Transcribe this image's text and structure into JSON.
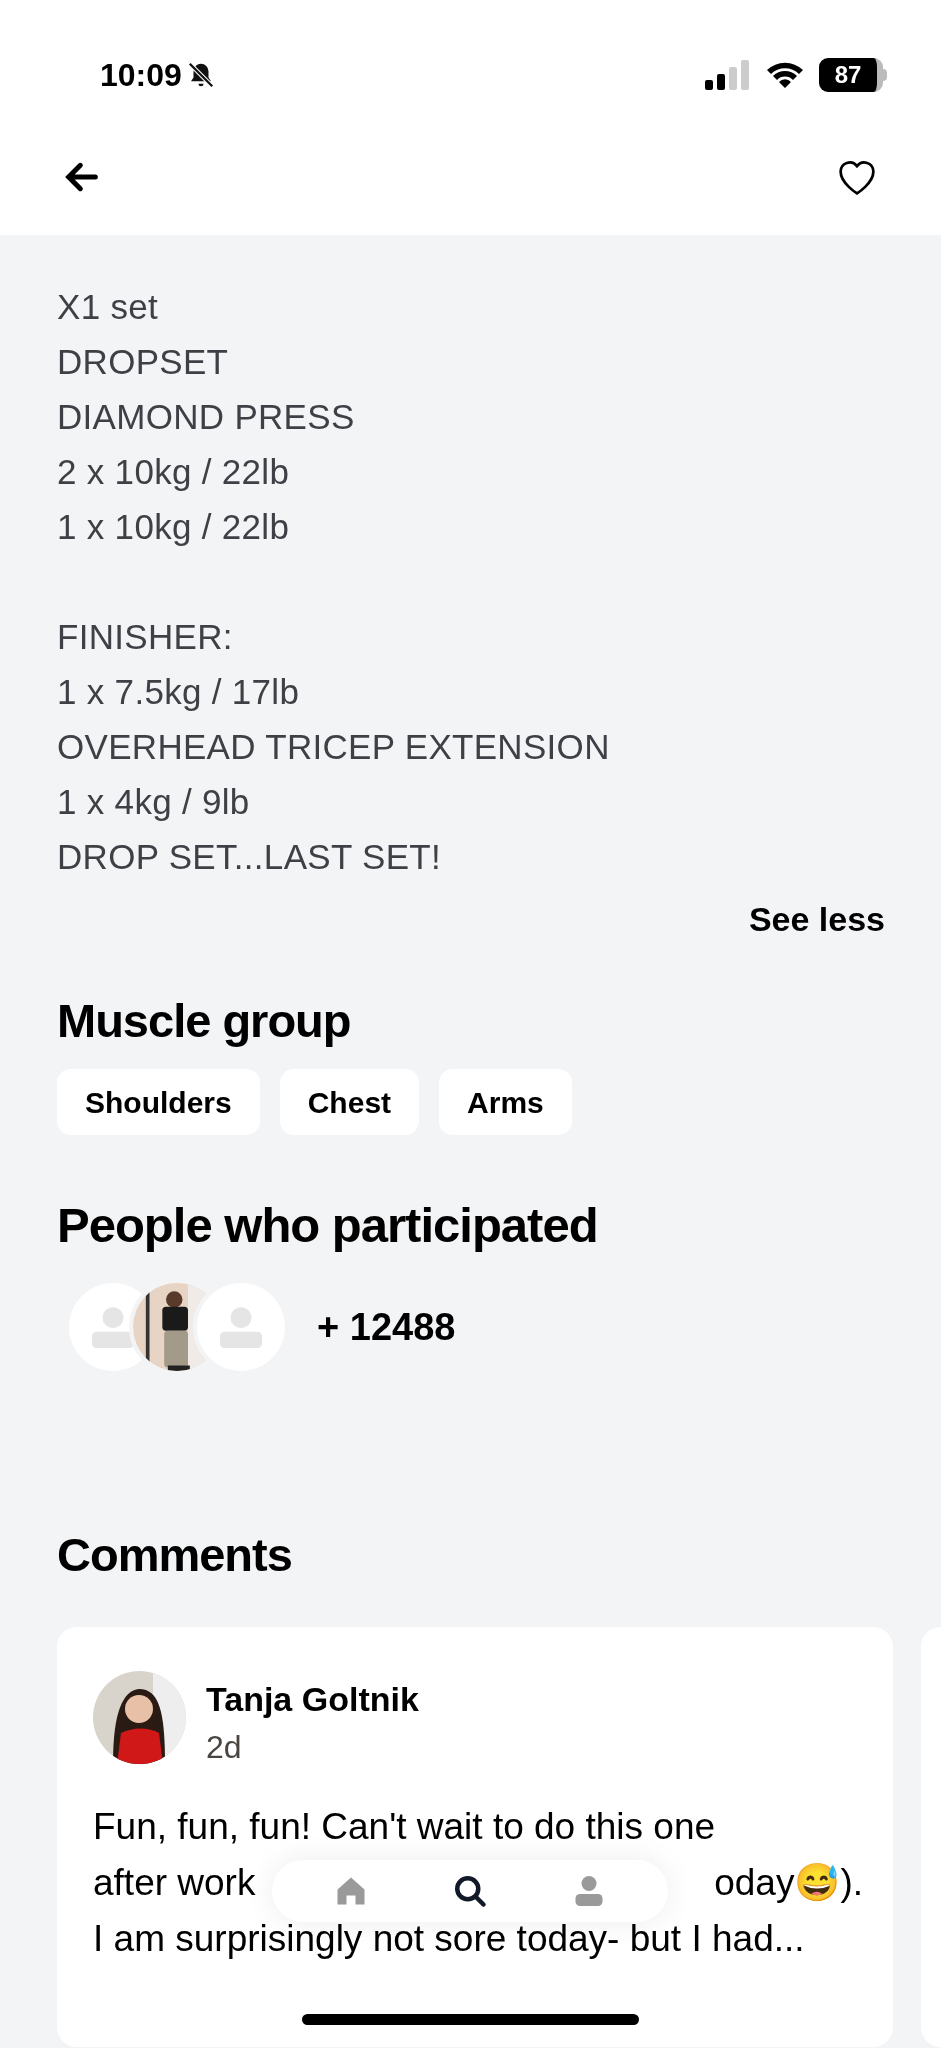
{
  "status_bar": {
    "time": "10:09",
    "battery": "87"
  },
  "description": {
    "paragraphs": [
      [
        "X1 set",
        "DROPSET",
        "DIAMOND PRESS",
        "2 x 10kg / 22lb",
        "1 x 10kg / 22lb"
      ],
      [
        "FINISHER:",
        "1 x 7.5kg / 17lb",
        "OVERHEAD TRICEP EXTENSION",
        "1 x 4kg / 9lb",
        "DROP SET...LAST SET!"
      ]
    ],
    "toggle": "See less"
  },
  "muscle_group": {
    "title": "Muscle group",
    "tags": [
      "Shoulders",
      "Chest",
      "Arms"
    ]
  },
  "participants": {
    "title": "People who participated",
    "avatars": [
      {
        "kind": "placeholder"
      },
      {
        "kind": "picture"
      },
      {
        "kind": "placeholder"
      }
    ],
    "count": "+ 12488"
  },
  "comments": {
    "title": "Comments",
    "items": [
      {
        "author": "Tanja Goltnik",
        "time": "2d",
        "lines": [
          [
            "Fun, fun, fun! Can't wait to do this one"
          ],
          [
            "after work",
            "oday😅)."
          ],
          [
            "I am surprisingly not sore today- but I had..."
          ]
        ]
      }
    ]
  },
  "bottom_nav": [
    {
      "kind": "home",
      "selected": false
    },
    {
      "kind": "search",
      "selected": true
    },
    {
      "kind": "profile",
      "selected": false
    }
  ]
}
